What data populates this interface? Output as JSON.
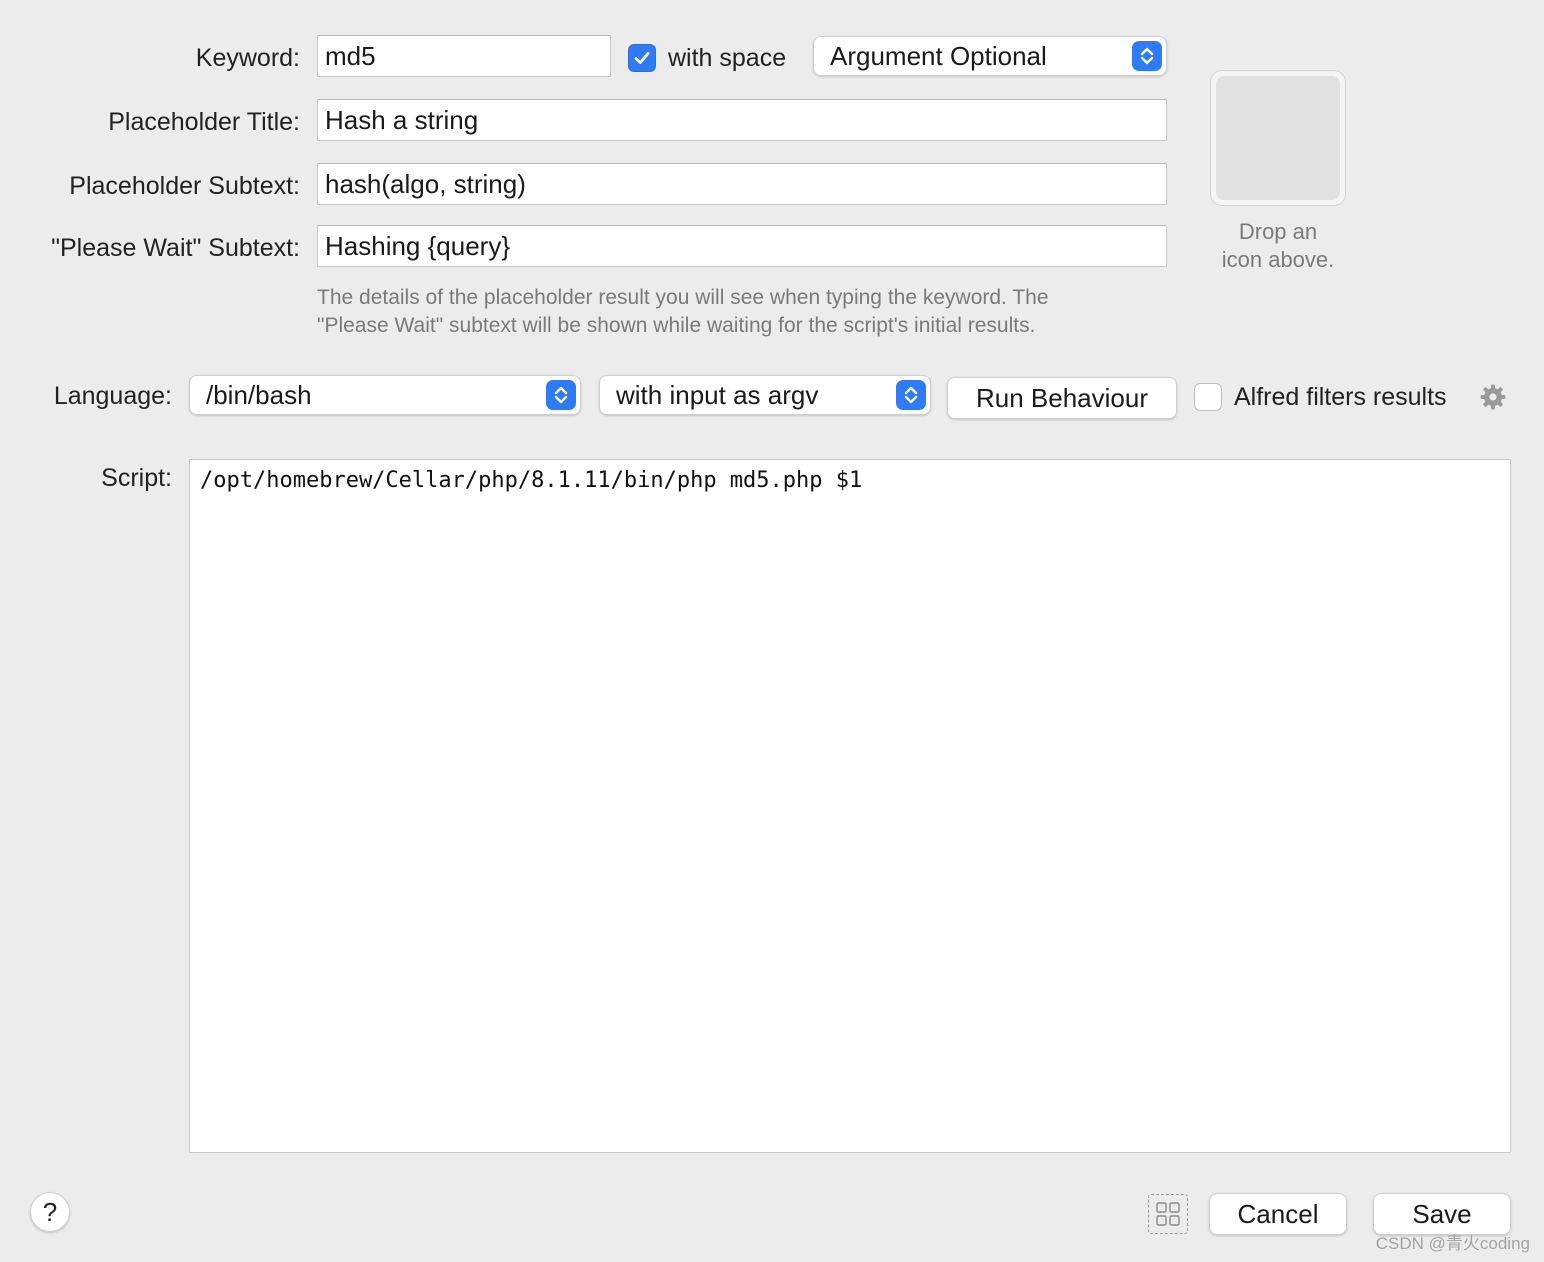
{
  "form": {
    "keyword_label": "Keyword:",
    "keyword_value": "md5",
    "with_space_label": "with space",
    "with_space_checked": true,
    "argument_mode": "Argument Optional",
    "placeholder_title_label": "Placeholder Title:",
    "placeholder_title_value": "Hash a string",
    "placeholder_subtext_label": "Placeholder Subtext:",
    "placeholder_subtext_value": "hash(algo, string)",
    "please_wait_label": "\"Please Wait\" Subtext:",
    "please_wait_value": "Hashing {query}",
    "hint_line1": "The details of the placeholder result you will see when typing the keyword. The",
    "hint_line2": "\"Please Wait\" subtext will be shown while waiting for the script's initial results."
  },
  "icon_well": {
    "caption_line1": "Drop an",
    "caption_line2": "icon above."
  },
  "script_settings": {
    "language_label": "Language:",
    "language_value": "/bin/bash",
    "input_mode": "with input as argv",
    "run_behaviour_label": "Run Behaviour",
    "alfred_filters_label": "Alfred filters results",
    "alfred_filters_checked": false
  },
  "script": {
    "label": "Script:",
    "content": "/opt/homebrew/Cellar/php/8.1.11/bin/php md5.php $1"
  },
  "footer": {
    "help_label": "?",
    "cancel_label": "Cancel",
    "save_label": "Save"
  },
  "watermark": "CSDN @青火coding",
  "colors": {
    "background": "#ececec",
    "accent": "#2f7bf5",
    "hint_text": "#7a7a7a"
  },
  "icons": [
    "checkmark-icon",
    "chevron-updown-icon",
    "gear-icon",
    "grid-icon",
    "help-icon"
  ]
}
